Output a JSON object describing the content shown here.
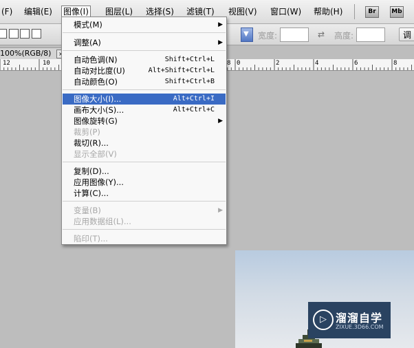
{
  "menubar": {
    "items": [
      "(F)",
      "编辑(E)",
      "图像(I)",
      "图层(L)",
      "选择(S)",
      "滤镜(T)",
      "视图(V)",
      "窗口(W)",
      "帮助(H)"
    ],
    "app_buttons": [
      "Br",
      "Mb"
    ]
  },
  "options_bar": {
    "width_label": "宽度:",
    "height_label": "高度:",
    "button_label": "调"
  },
  "document_tab": {
    "title": "100%(RGB/8)",
    "close_glyph": "×"
  },
  "ruler": {
    "labels": [
      "12",
      "10",
      "8",
      "0",
      "2",
      "4",
      "6",
      "8",
      "1"
    ]
  },
  "image_menu": {
    "items": [
      {
        "label": "模式(M)",
        "shortcut": "",
        "submenu": true,
        "disabled": false,
        "highlighted": false
      },
      {
        "label": "调整(A)",
        "shortcut": "",
        "submenu": true,
        "disabled": false,
        "highlighted": false
      },
      {
        "label": "自动色调(N)",
        "shortcut": "Shift+Ctrl+L",
        "submenu": false,
        "disabled": false,
        "highlighted": false
      },
      {
        "label": "自动对比度(U)",
        "shortcut": "Alt+Shift+Ctrl+L",
        "submenu": false,
        "disabled": false,
        "highlighted": false
      },
      {
        "label": "自动颜色(O)",
        "shortcut": "Shift+Ctrl+B",
        "submenu": false,
        "disabled": false,
        "highlighted": false
      },
      {
        "label": "图像大小(I)...",
        "shortcut": "Alt+Ctrl+I",
        "submenu": false,
        "disabled": false,
        "highlighted": true
      },
      {
        "label": "画布大小(S)...",
        "shortcut": "Alt+Ctrl+C",
        "submenu": false,
        "disabled": false,
        "highlighted": false
      },
      {
        "label": "图像旋转(G)",
        "shortcut": "",
        "submenu": true,
        "disabled": false,
        "highlighted": false
      },
      {
        "label": "裁剪(P)",
        "shortcut": "",
        "submenu": false,
        "disabled": true,
        "highlighted": false
      },
      {
        "label": "裁切(R)...",
        "shortcut": "",
        "submenu": false,
        "disabled": false,
        "highlighted": false
      },
      {
        "label": "显示全部(V)",
        "shortcut": "",
        "submenu": false,
        "disabled": true,
        "highlighted": false
      },
      {
        "label": "复制(D)...",
        "shortcut": "",
        "submenu": false,
        "disabled": false,
        "highlighted": false
      },
      {
        "label": "应用图像(Y)...",
        "shortcut": "",
        "submenu": false,
        "disabled": false,
        "highlighted": false
      },
      {
        "label": "计算(C)...",
        "shortcut": "",
        "submenu": false,
        "disabled": false,
        "highlighted": false
      },
      {
        "label": "变量(B)",
        "shortcut": "",
        "submenu": true,
        "disabled": true,
        "highlighted": false
      },
      {
        "label": "应用数据组(L)...",
        "shortcut": "",
        "submenu": false,
        "disabled": true,
        "highlighted": false
      },
      {
        "label": "陷印(T)...",
        "shortcut": "",
        "submenu": false,
        "disabled": true,
        "highlighted": false
      }
    ]
  },
  "watermark": {
    "title": "溜溜自学",
    "subtitle": "ZIXUE.3D66.COM"
  },
  "colors": {
    "highlight": "#3a6bc4",
    "disabled_text": "#a7a7a7",
    "workspace": "#bdbdbd",
    "watermark_bg": "#2a4361"
  }
}
